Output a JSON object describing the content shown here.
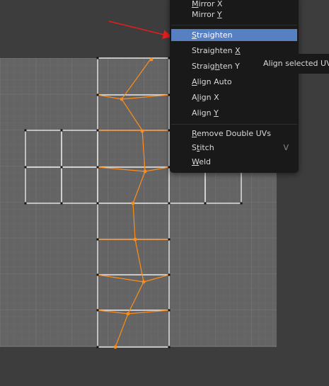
{
  "menu": {
    "items": [
      {
        "id": "mirror-x",
        "pre": "",
        "ul": "M",
        "post": "irror X"
      },
      {
        "id": "mirror-y",
        "pre": "Mirror ",
        "ul": "Y",
        "post": ""
      },
      {
        "id": "straighten",
        "pre": "",
        "ul": "S",
        "post": "traighten",
        "active": true
      },
      {
        "id": "straighten-x",
        "pre": "Straighten ",
        "ul": "X",
        "post": ""
      },
      {
        "id": "straighten-y",
        "pre": "Straig",
        "ul": "h",
        "post": "ten Y"
      },
      {
        "id": "align-auto",
        "pre": "",
        "ul": "A",
        "post": "lign Auto"
      },
      {
        "id": "align-x",
        "pre": "A",
        "ul": "l",
        "post": "ign X"
      },
      {
        "id": "align-y",
        "pre": "Align ",
        "ul": "Y",
        "post": ""
      },
      {
        "id": "remove-doubles",
        "pre": "",
        "ul": "R",
        "post": "emove Double UVs"
      },
      {
        "id": "stitch",
        "pre": "S",
        "ul": "t",
        "post": "itch",
        "shortcut": "V"
      },
      {
        "id": "weld",
        "pre": "",
        "ul": "W",
        "post": "eld"
      }
    ]
  },
  "tooltip": {
    "text": "Align selected UV v"
  },
  "colors": {
    "background": "#3d3d3d",
    "canvas": "#646464",
    "edge": "#e8e8e8",
    "selected": "#ff8c1a",
    "highlight": "#5680c2",
    "arrow": "#e41e1e"
  }
}
